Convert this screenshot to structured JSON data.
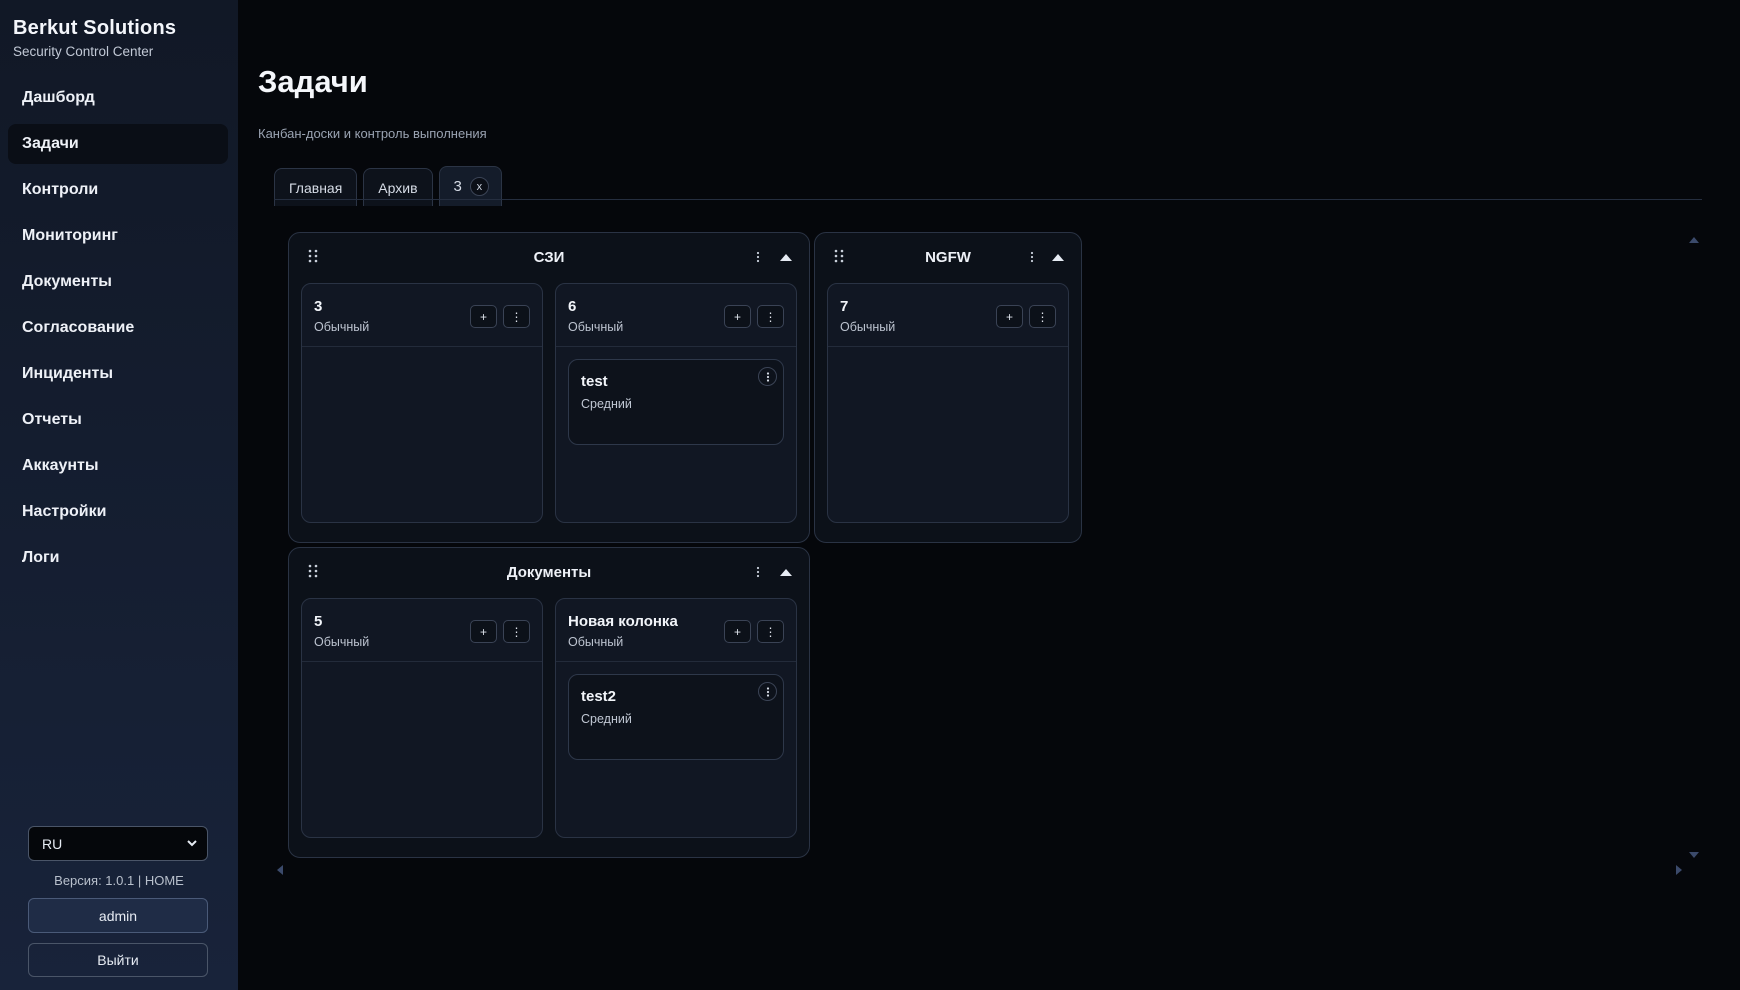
{
  "brand": {
    "name": "Berkut Solutions",
    "subtitle": "Security Control Center"
  },
  "sidebar": {
    "items": [
      {
        "label": "Дашборд",
        "active": false
      },
      {
        "label": "Задачи",
        "active": true
      },
      {
        "label": "Контроли",
        "active": false
      },
      {
        "label": "Мониторинг",
        "active": false
      },
      {
        "label": "Документы",
        "active": false
      },
      {
        "label": "Согласование",
        "active": false
      },
      {
        "label": "Инциденты",
        "active": false
      },
      {
        "label": "Отчеты",
        "active": false
      },
      {
        "label": "Аккаунты",
        "active": false
      },
      {
        "label": "Настройки",
        "active": false
      },
      {
        "label": "Логи",
        "active": false
      }
    ],
    "language": "RU",
    "version": "Версия: 1.0.1 | HOME",
    "user": "admin",
    "logout": "Выйти"
  },
  "page": {
    "title": "Задачи",
    "subtitle": "Канбан-доски и контроль выполнения"
  },
  "tabs": [
    {
      "label": "Главная"
    },
    {
      "label": "Архив"
    },
    {
      "label": "3",
      "active": true,
      "close": "x"
    }
  ],
  "groups": [
    {
      "title": "СЗИ",
      "columns": [
        {
          "title": "3",
          "type": "Обычный",
          "cards": []
        },
        {
          "title": "6",
          "type": "Обычный",
          "cards": [
            {
              "title": "test",
              "priority": "Средний"
            }
          ]
        }
      ]
    },
    {
      "title": "NGFW",
      "columns": [
        {
          "title": "7",
          "type": "Обычный",
          "cards": []
        }
      ]
    },
    {
      "title": "Документы",
      "columns": [
        {
          "title": "5",
          "type": "Обычный",
          "cards": []
        },
        {
          "title": "Новая колонка",
          "type": "Обычный",
          "cards": [
            {
              "title": "test2",
              "priority": "Средний"
            }
          ]
        }
      ]
    }
  ],
  "column_actions": {
    "add": "+",
    "more": "⋮"
  },
  "colors": {
    "background": "#05070b",
    "sidebar": "#151f32",
    "accent": "#3b4a6b",
    "active_nav": "#0a0e16"
  }
}
